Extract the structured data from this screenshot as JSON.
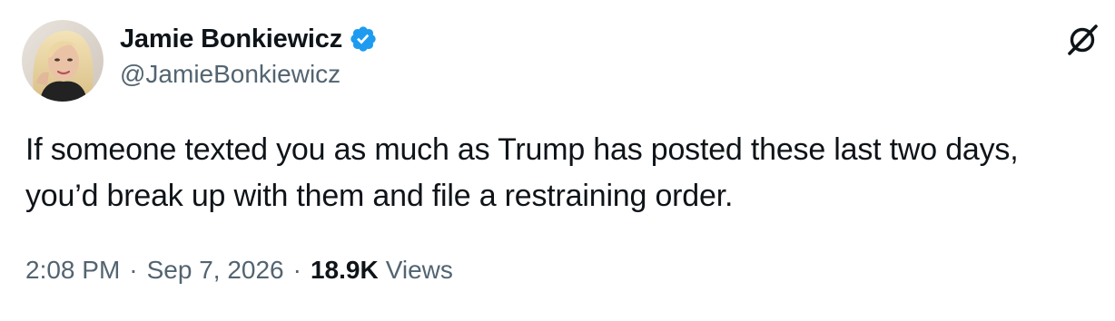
{
  "author": {
    "display_name": "Jamie Bonkiewicz",
    "handle": "@JamieBonkiewicz",
    "verified": true,
    "avatar_icon": "profile-photo"
  },
  "platform_icon": "x-logo-icon",
  "tweet": {
    "text": "If someone texted you as much as Trump has posted these last two days, you’d break up with them and file a restraining order.",
    "time": "2:08 PM",
    "date": "Sep 7, 2026",
    "separator": "·",
    "views_count": "18.9K",
    "views_label": "Views"
  },
  "colors": {
    "verified_blue": "#1d9bf0",
    "secondary_text": "#536471",
    "primary_text": "#0f1419"
  }
}
